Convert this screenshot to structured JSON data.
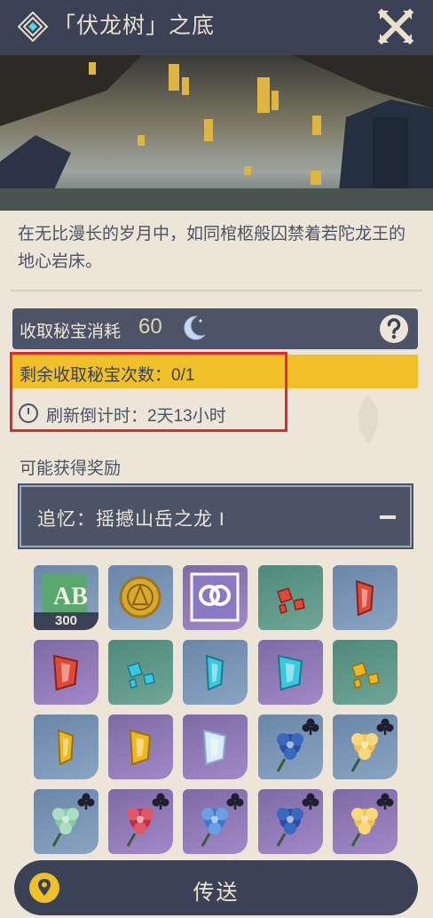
{
  "header": {
    "title": "「伏龙树」之底",
    "icon": "domain-diamond-icon",
    "close_icon": "close-cross-icon"
  },
  "banner": {
    "alt": ""
  },
  "description": "在无比漫长的岁月中，如同棺柩般囚禁着若陀龙王的地心岩床。",
  "cost": {
    "label": "收取秘宝消耗",
    "value": "60",
    "icon": "moon-resin-icon",
    "help_icon": "help-icon"
  },
  "remaining": {
    "text": "剩余收取秘宝次数：0/1"
  },
  "refresh": {
    "text": "刷新倒计时：2天13小时",
    "icon": "clock-icon"
  },
  "rewards": {
    "title": "可能获得奖励",
    "section_label": "追忆：摇撼山岳之龙 I",
    "items": [
      {
        "name": "exp-book",
        "bg": "blue",
        "count": "300"
      },
      {
        "name": "mora-coin",
        "bg": "blue",
        "count": ""
      },
      {
        "name": "companionship-exp",
        "bg": "purple",
        "count": ""
      },
      {
        "name": "red-crystal-fragment",
        "bg": "green",
        "count": ""
      },
      {
        "name": "red-crystal-chunk",
        "bg": "blue",
        "count": ""
      },
      {
        "name": "red-crystal-gem",
        "bg": "purple",
        "count": ""
      },
      {
        "name": "cyan-crystal-fragment",
        "bg": "green",
        "count": ""
      },
      {
        "name": "cyan-crystal-chunk",
        "bg": "blue",
        "count": ""
      },
      {
        "name": "cyan-crystal-gem",
        "bg": "purple",
        "count": ""
      },
      {
        "name": "gold-crystal-fragment",
        "bg": "green",
        "count": ""
      },
      {
        "name": "gold-crystal-chunk",
        "bg": "blue",
        "count": ""
      },
      {
        "name": "gold-crystal-gem",
        "bg": "purple",
        "count": ""
      },
      {
        "name": "ice-crystal-gem",
        "bg": "purple",
        "count": ""
      },
      {
        "name": "blue-rose-flower",
        "bg": "blue",
        "count": "",
        "badge": true
      },
      {
        "name": "gold-lily-flower",
        "bg": "blue",
        "count": "",
        "badge": true
      },
      {
        "name": "green-succulent-flower",
        "bg": "blue",
        "count": "",
        "badge": true
      },
      {
        "name": "red-star-flower",
        "bg": "purple",
        "count": "",
        "badge": true
      },
      {
        "name": "blue-morning-flower",
        "bg": "purple",
        "count": "",
        "badge": true
      },
      {
        "name": "blue-rose-flower-2",
        "bg": "purple",
        "count": "",
        "badge": true
      },
      {
        "name": "gold-lily-flower-2",
        "bg": "purple",
        "count": "",
        "badge": true
      }
    ]
  },
  "teleport": {
    "label": "传送",
    "icon": "location-pin-icon"
  },
  "colors": {
    "header": "#3b4255",
    "accent_yellow": "#f0c028",
    "highlight_red": "#e5262b",
    "panel_bg": "#ece5d8"
  }
}
